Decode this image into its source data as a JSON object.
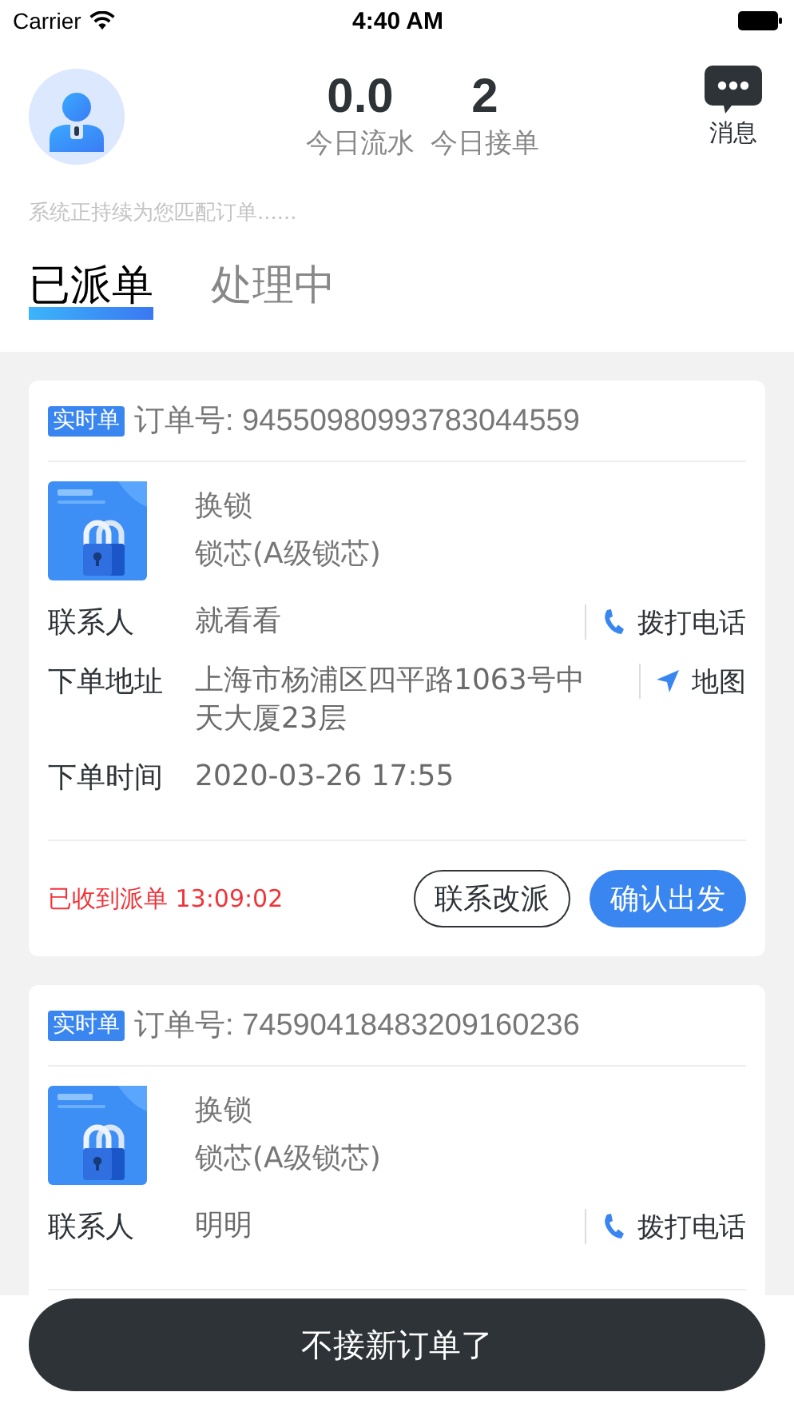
{
  "status_bar": {
    "carrier": "Carrier",
    "time": "4:40 AM"
  },
  "header": {
    "stats": [
      {
        "value": "0.0",
        "label": "今日流水"
      },
      {
        "value": "2",
        "label": "今日接单"
      }
    ],
    "messages_label": "消息"
  },
  "hint": "系统正持续为您匹配订单......",
  "tabs": [
    {
      "label": "已派单",
      "selected": true
    },
    {
      "label": "处理中",
      "selected": false
    }
  ],
  "orders": [
    {
      "badge": "实时单",
      "order_no": "订单号: 94550980993783044559",
      "product": {
        "kind": "picture"
      },
      "service": "换锁",
      "item": "锁芯(A级锁芯)",
      "fields": [
        {
          "kind": "phone",
          "label": "联系人",
          "value": "就看看",
          "action": "拨打电话"
        },
        {
          "kind": "map",
          "label": "下单地址",
          "value": "上海市杨浦区四平路1063号中天大厦23层",
          "action": "地图"
        },
        {
          "kind": "plain",
          "label": "下单时间",
          "value": "2020-03-26 17:55"
        }
      ],
      "status": "已收到派单 13:09:02",
      "buttons": [
        {
          "label": "联系改派",
          "kind": "outline"
        },
        {
          "label": "确认出发",
          "kind": "primary"
        }
      ]
    },
    {
      "badge": "实时单",
      "order_no": "订单号: 74590418483209160236",
      "product": {
        "kind": "picture"
      },
      "service": "换锁",
      "item": "锁芯(A级锁芯)",
      "fields": [
        {
          "kind": "phone",
          "label": "联系人",
          "value": "明明",
          "action": "拨打电话"
        }
      ]
    }
  ],
  "footer_button": "不接新订单了"
}
